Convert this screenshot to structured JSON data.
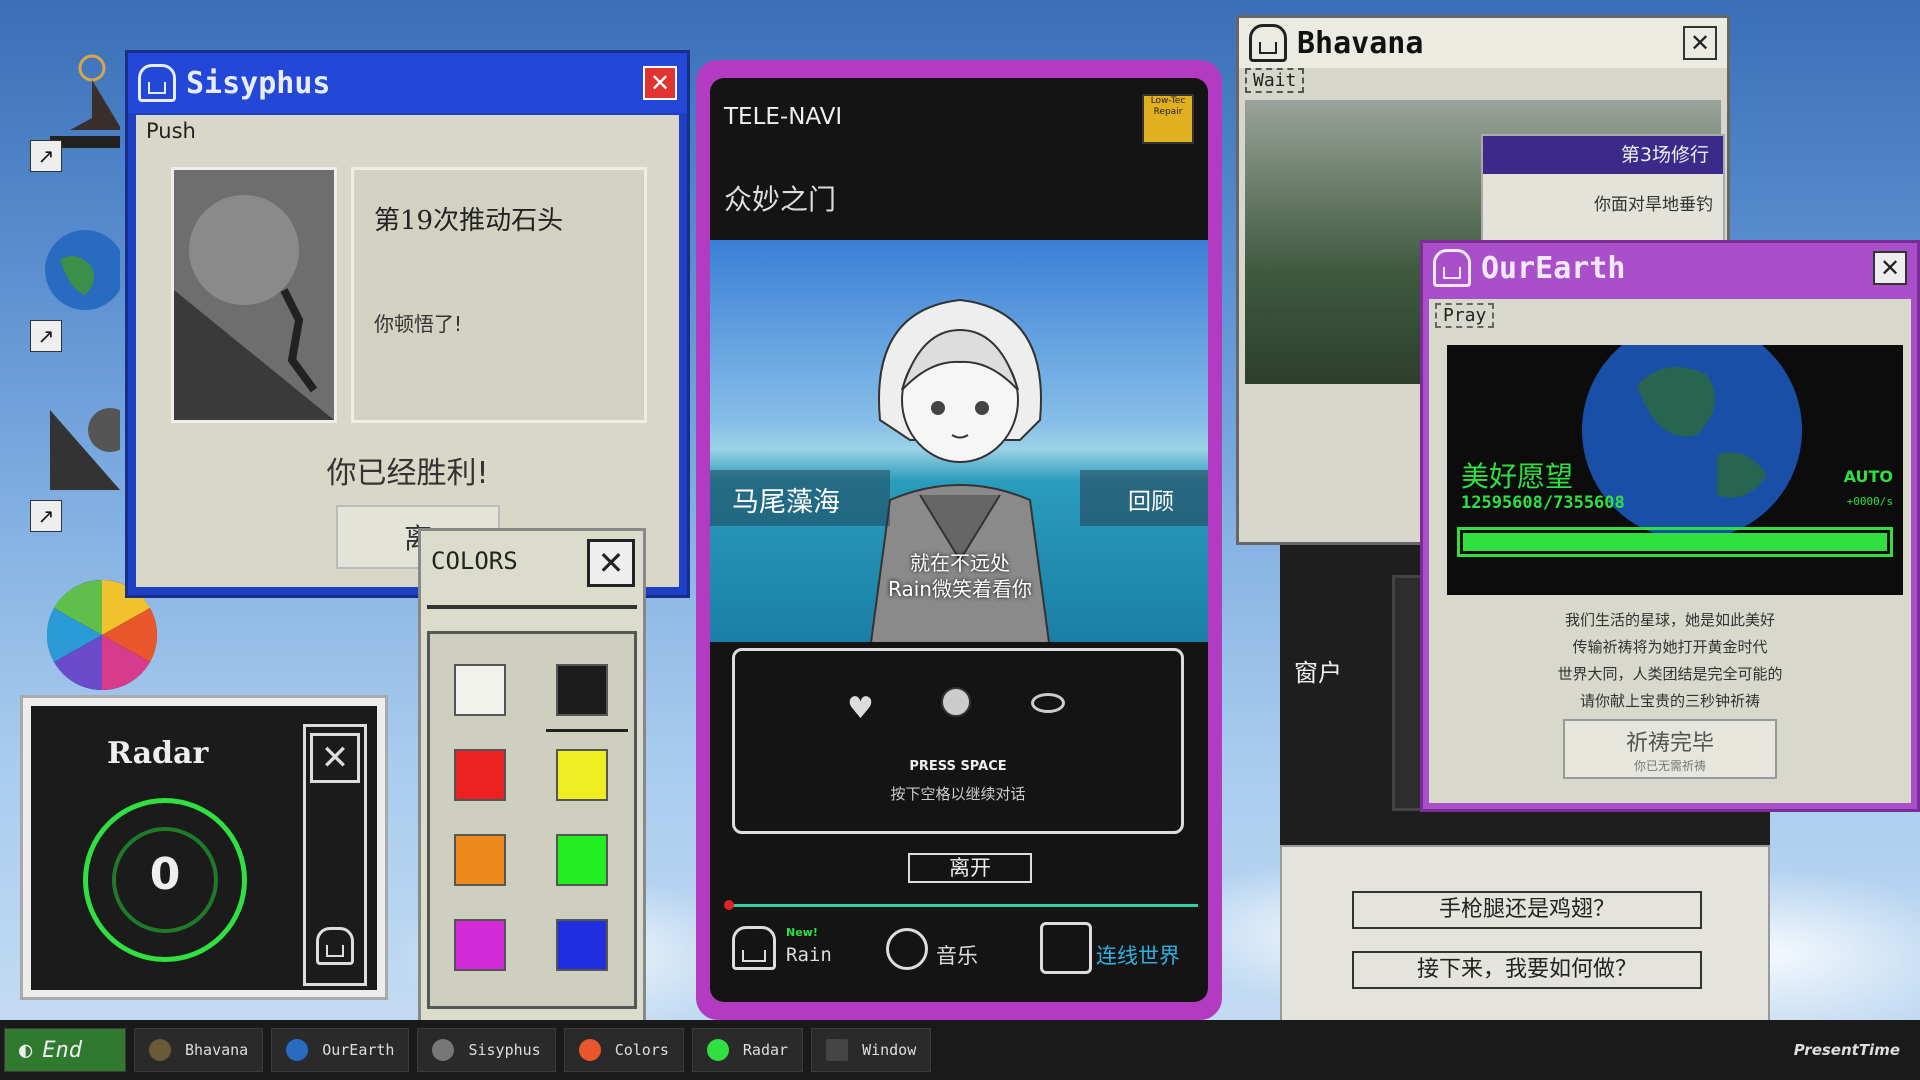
{
  "desktop": {},
  "sisyphus": {
    "title": "Sisyphus",
    "menu": "Push",
    "push_count": "第19次推动石头",
    "message": "你顿悟了!",
    "victory": "你已经胜利!",
    "leave_partial": "离"
  },
  "colors": {
    "title": "COLORS",
    "swatches": [
      "#f2f2ec",
      "#1c1c1c",
      "#ee2222",
      "#eeee22",
      "#ee8a1c",
      "#22ee22",
      "#d42bd8",
      "#1f2fe0"
    ]
  },
  "telenavi": {
    "header": "TELE-NAVI",
    "badge": "Low-Tec Repair",
    "subtitle": "众妙之门",
    "location": "马尾藻海",
    "review": "回顾",
    "dialogue_line1": "就在不远处",
    "dialogue_line2": "Rain微笑着看你",
    "press_space": "PRESS SPACE",
    "press_hint": "按下空格以继续对话",
    "leave": "离开",
    "new_badge": "New!",
    "nav_rain": "Rain",
    "nav_music": "音乐",
    "nav_online": "连线世界"
  },
  "bhavana": {
    "title": "Bhavana",
    "menu": "Wait",
    "session": "第3场修行",
    "text_partial": "你面对旱地垂钓",
    "window_label": "窗户",
    "option1": "手枪腿还是鸡翅？",
    "option2": "接下来，我要如何做？"
  },
  "ourearth": {
    "title": "OurEarth",
    "menu": "Pray",
    "wish_title": "美好愿望",
    "auto": "AUTO",
    "counter": "12595608/7355608",
    "rate": "+0000/s",
    "progress": 1.0,
    "desc": [
      "我们生活的星球，她是如此美好",
      "传输祈祷将为她打开黄金时代",
      "世界大同，人类团结是完全可能的",
      "请你献上宝贵的三秒钟祈祷"
    ],
    "button_main": "祈祷完毕",
    "button_sub": "你已无需祈祷"
  },
  "radar": {
    "title": "Radar",
    "value": "0"
  },
  "taskbar": {
    "start": "End",
    "items": [
      "Bhavana",
      "OurEarth",
      "Sisyphus",
      "Colors",
      "Radar",
      "Window"
    ],
    "brand": "PresentTime"
  },
  "colors_theme": {
    "sisyphus_blue": "#2347d6",
    "telenavi_purple": "#b33bc2",
    "ourearth_purple": "#a94fc9",
    "bhavana_purple": "#3b2a8a",
    "progress_green": "#22e03a"
  }
}
